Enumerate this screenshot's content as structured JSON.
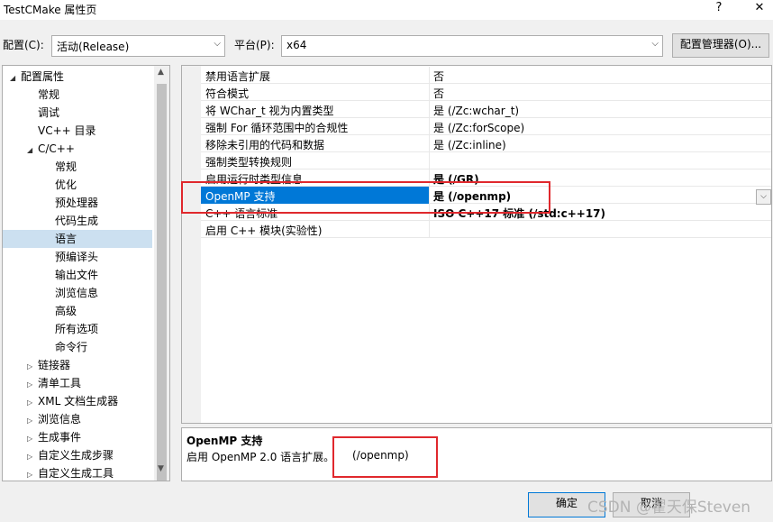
{
  "window": {
    "title": "TestCMake 属性页",
    "help_label": "?",
    "close_label": "✕"
  },
  "config_row": {
    "config_label": "配置(C):",
    "config_value": "活动(Release)",
    "platform_label": "平台(P):",
    "platform_value": "x64",
    "manager_button": "配置管理器(O)..."
  },
  "tree": {
    "items": [
      {
        "label": "配置属性",
        "expanded": true
      },
      {
        "label": "常规"
      },
      {
        "label": "调试"
      },
      {
        "label": "VC++ 目录"
      },
      {
        "label": "C/C++",
        "expanded": true
      },
      {
        "label": "常规"
      },
      {
        "label": "优化"
      },
      {
        "label": "预处理器"
      },
      {
        "label": "代码生成"
      },
      {
        "label": "语言",
        "selected": true
      },
      {
        "label": "预编译头"
      },
      {
        "label": "输出文件"
      },
      {
        "label": "浏览信息"
      },
      {
        "label": "高级"
      },
      {
        "label": "所有选项"
      },
      {
        "label": "命令行"
      },
      {
        "label": "链接器",
        "expanded": false
      },
      {
        "label": "清单工具",
        "expanded": false
      },
      {
        "label": "XML 文档生成器",
        "expanded": false
      },
      {
        "label": "浏览信息",
        "expanded": false
      },
      {
        "label": "生成事件",
        "expanded": false
      },
      {
        "label": "自定义生成步骤",
        "expanded": false
      },
      {
        "label": "自定义生成工具",
        "expanded": false
      }
    ]
  },
  "properties": [
    {
      "name": "禁用语言扩展",
      "value": "否"
    },
    {
      "name": "符合模式",
      "value": "否"
    },
    {
      "name": "将 WChar_t 视为内置类型",
      "value": "是 (/Zc:wchar_t)"
    },
    {
      "name": "强制 For 循环范围中的合规性",
      "value": "是 (/Zc:forScope)"
    },
    {
      "name": "移除未引用的代码和数据",
      "value": "是 (/Zc:inline)"
    },
    {
      "name": "强制类型转换规则",
      "value": ""
    },
    {
      "name": "启用运行时类型信息",
      "value": "是 (/GR)",
      "bold": true
    },
    {
      "name": "OpenMP 支持",
      "value": "是 (/openmp)",
      "bold": true,
      "selected": true
    },
    {
      "name": "C++ 语言标准",
      "value": "ISO C++17 标准 (/std:c++17)",
      "bold": true
    },
    {
      "name": "启用 C++ 模块(实验性)",
      "value": ""
    }
  ],
  "description": {
    "title": "OpenMP 支持",
    "text": "启用 OpenMP 2.0 语言扩展。",
    "flag": "(/openmp)"
  },
  "buttons": {
    "ok": "确定",
    "cancel": "取消"
  },
  "watermark": "CSDN @翟天保Steven",
  "colors": {
    "selection": "#0078d7",
    "tree_selection": "#cce0f0",
    "highlight_box": "#e0282d"
  }
}
